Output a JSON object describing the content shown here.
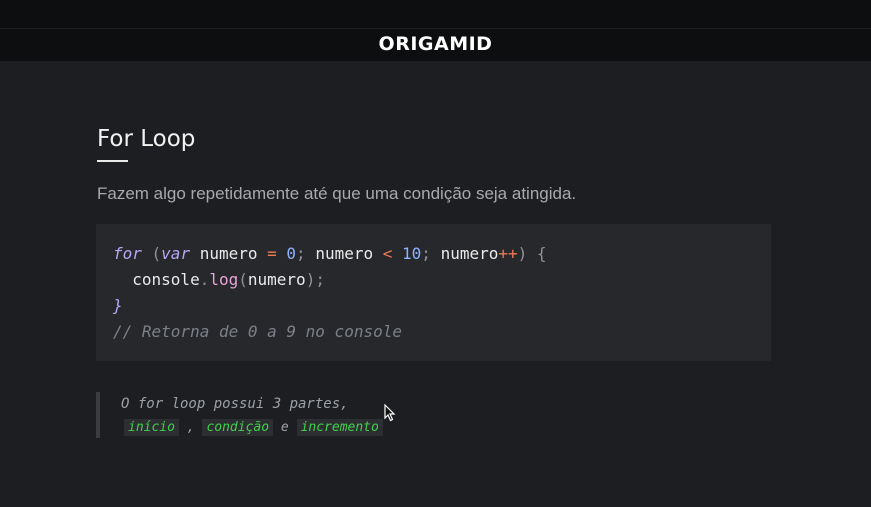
{
  "header": {
    "logo_text": "ORIGAMID"
  },
  "lesson": {
    "title": "For Loop",
    "subtitle": "Fazem algo repetidamente até que uma condição seja atingida."
  },
  "code": {
    "line1": {
      "kw_for": "for",
      "paren_open": " (",
      "kw_var": "var",
      "ident1": " numero ",
      "op_eq": "=",
      "num0": " 0",
      "semi1": "; ",
      "ident2": "numero ",
      "op_lt": "<",
      "num10": " 10",
      "semi2": "; ",
      "ident3": "numero",
      "op_inc": "++",
      "paren_close": ") ",
      "brace_open": "{"
    },
    "line2": {
      "indent_ident": "  console",
      "dot": ".",
      "fn_log": "log",
      "paren": "(",
      "arg": "numero",
      "close": ");"
    },
    "line3": {
      "brace_close": "}"
    },
    "line4": {
      "comment": "// Retorna de 0 a 9 no console"
    }
  },
  "note": {
    "text": "O for loop possui 3 partes,",
    "part1": "início",
    "sep1": " , ",
    "part2": "condição",
    "sep2": " e ",
    "part3": "incremento"
  },
  "colors": {
    "background": "#1c1e21",
    "code_background": "#26282b",
    "keyword": "#b8a6f5",
    "operator": "#f07a55",
    "number": "#8fb3ff",
    "function": "#e8a3d9",
    "tag_text": "#3fd04b"
  },
  "icons": {
    "cursor": "mouse-pointer-icon"
  }
}
